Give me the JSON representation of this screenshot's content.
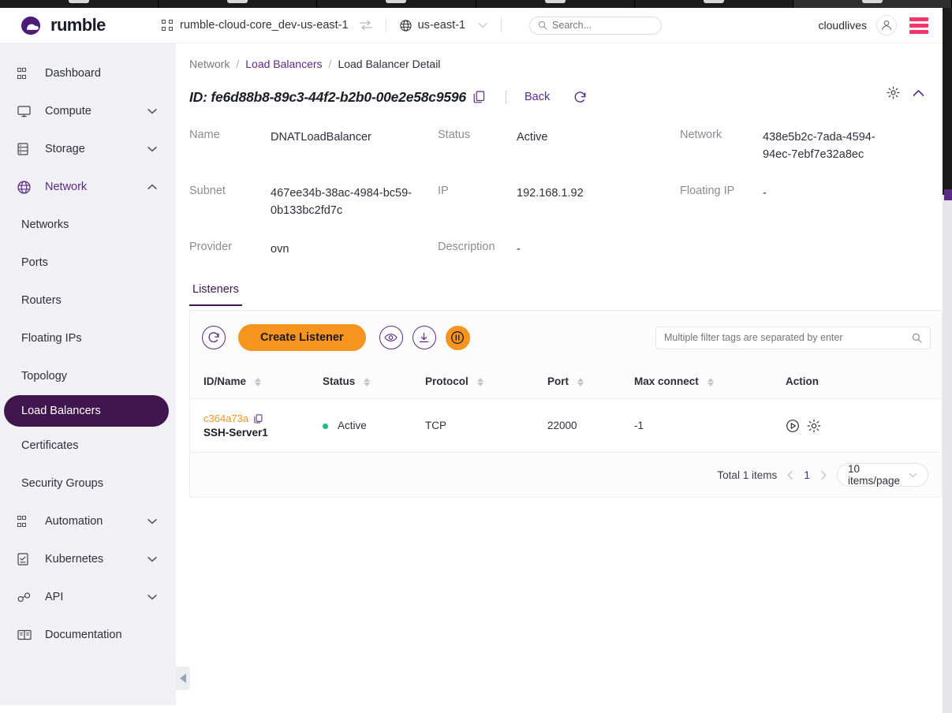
{
  "header": {
    "brand": "rumble",
    "brand_logo_icon": "cloud-icon",
    "project_switcher_icon": "grid-icon",
    "project_name": "rumble-cloud-core_dev-us-east-1",
    "project_switch_icon": "switch-arrows-icon",
    "region_icon": "globe-icon",
    "region_name": "us-east-1",
    "region_caret_icon": "chevron-down-icon",
    "search_placeholder": "Search...",
    "search_value": "",
    "search_icon": "search-icon",
    "user_name": "cloudlives",
    "avatar_icon": "user-avatar-icon",
    "menu_icon": "hamburger-menu-icon",
    "menu_color": "#f5366a"
  },
  "sidebar": {
    "items": [
      {
        "label": "Dashboard",
        "icon": "grid-icon",
        "caret": "",
        "type": "top"
      },
      {
        "label": "Compute",
        "icon": "monitor-icon",
        "caret": "chevron-down-icon",
        "type": "top"
      },
      {
        "label": "Storage",
        "icon": "database-icon",
        "caret": "chevron-down-icon",
        "type": "top"
      },
      {
        "label": "Network",
        "icon": "globe-icon",
        "caret": "chevron-up-icon",
        "type": "top-active"
      },
      {
        "label": "Networks",
        "icon": "",
        "caret": "",
        "type": "sub"
      },
      {
        "label": "Ports",
        "icon": "",
        "caret": "",
        "type": "sub"
      },
      {
        "label": "Routers",
        "icon": "",
        "caret": "",
        "type": "sub"
      },
      {
        "label": "Floating IPs",
        "icon": "",
        "caret": "",
        "type": "sub"
      },
      {
        "label": "Topology",
        "icon": "",
        "caret": "",
        "type": "sub"
      },
      {
        "label": "Load Balancers",
        "icon": "",
        "caret": "",
        "type": "sub-selected"
      },
      {
        "label": "Certificates",
        "icon": "",
        "caret": "",
        "type": "sub"
      },
      {
        "label": "Security Groups",
        "icon": "",
        "caret": "",
        "type": "sub"
      },
      {
        "label": "Automation",
        "icon": "grid-icon",
        "caret": "chevron-down-icon",
        "type": "top"
      },
      {
        "label": "Kubernetes",
        "icon": "clipboard-icon",
        "caret": "chevron-down-icon",
        "type": "top"
      },
      {
        "label": "API",
        "icon": "api-icon",
        "caret": "chevron-down-icon",
        "type": "top"
      },
      {
        "label": "Documentation",
        "icon": "book-icon",
        "caret": "",
        "type": "top"
      }
    ],
    "collapse_icon": "collapse-left-arrow-icon"
  },
  "breadcrumb": {
    "root": "Network",
    "sep1": "/",
    "parent": "Load Balancers",
    "sep2": "/",
    "current": "Load Balancer Detail"
  },
  "detail": {
    "id_label": "ID: fe6d88b8-89c3-44f2-b2b0-00e2e58c9596",
    "copy_icon": "copy-icon",
    "back_label": "Back",
    "refresh_icon": "refresh-icon",
    "gear_icon": "gear-icon",
    "collapse_icon": "chevron-up-icon",
    "fields": {
      "name_label": "Name",
      "name_value": "DNATLoadBalancer",
      "status_label": "Status",
      "status_value": "Active",
      "network_label": "Network",
      "network_value": "438e5b2c-7ada-4594-94ec-7ebf7e32a8ec",
      "subnet_label": "Subnet",
      "subnet_value": "467ee34b-38ac-4984-bc59-0b133bc2fd7c",
      "ip_label": "IP",
      "ip_value": "192.168.1.92",
      "floating_ip_label": "Floating IP",
      "floating_ip_value": "-",
      "provider_label": "Provider",
      "provider_value": "ovn",
      "description_label": "Description",
      "description_value": "-"
    }
  },
  "tabs": [
    {
      "label": "Listeners",
      "active": true
    }
  ],
  "toolbar": {
    "refresh_icon": "refresh-icon",
    "create_label": "Create Listener",
    "eye_icon": "eye-icon",
    "download_icon": "download-icon",
    "pause_icon": "pause-circle-icon",
    "filter_placeholder": "Multiple filter tags are separated by enter",
    "filter_value": "",
    "filter_search_icon": "search-icon",
    "accent_orange": "#f79420",
    "accent_purple": "#5b2a86"
  },
  "table": {
    "columns": [
      {
        "label": "ID/Name",
        "sortable": true
      },
      {
        "label": "Status",
        "sortable": true
      },
      {
        "label": "Protocol",
        "sortable": true
      },
      {
        "label": "Port",
        "sortable": true
      },
      {
        "label": "Max connect",
        "sortable": true
      },
      {
        "label": "Action",
        "sortable": false
      }
    ],
    "rows": [
      {
        "id": "c364a73a",
        "copy_icon": "copy-icon",
        "name": "SSH-Server1",
        "status": "Active",
        "status_color": "#18c07a",
        "protocol": "TCP",
        "port": "22000",
        "max_connect": "-1",
        "action_play_icon": "play-circle-icon",
        "action_gear_icon": "gear-icon"
      }
    ]
  },
  "pagination": {
    "total_label": "Total 1 items",
    "prev_icon": "chevron-left-icon",
    "current_page": "1",
    "next_icon": "chevron-right-icon",
    "page_size": "10 items/page",
    "page_size_caret": "chevron-down-icon"
  }
}
